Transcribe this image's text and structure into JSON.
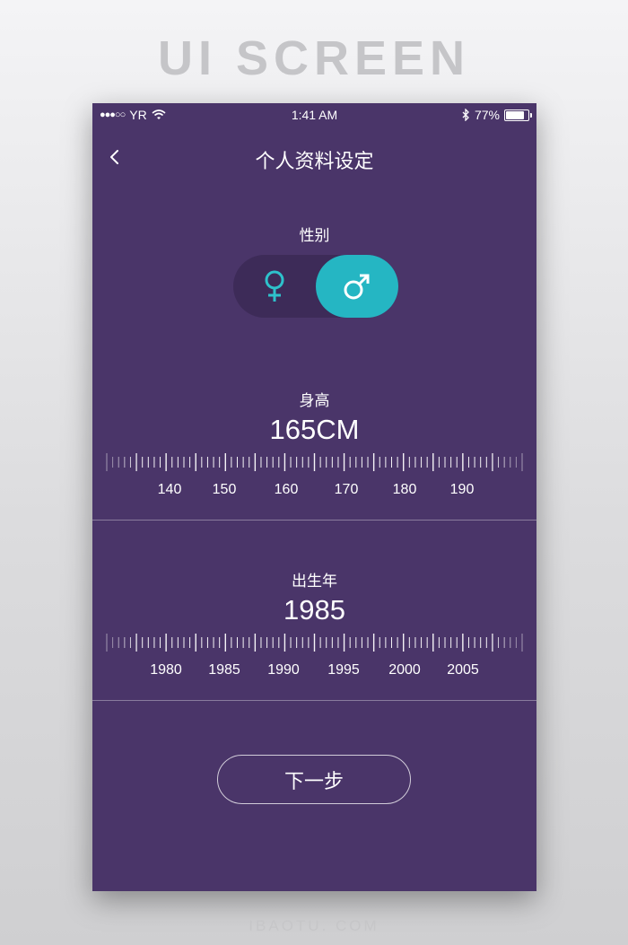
{
  "page_heading": "UI SCREEN",
  "footer_watermark": "IBAOTU. COM",
  "status_bar": {
    "carrier": "YR",
    "time": "1:41 AM",
    "battery": "77%",
    "battery_level": 0.77
  },
  "nav": {
    "title": "个人资料设定",
    "back_icon": "chevron-left-icon"
  },
  "gender": {
    "label": "性别",
    "options": [
      {
        "icon": "female-icon",
        "selected": false
      },
      {
        "icon": "male-icon",
        "selected": true
      }
    ]
  },
  "height": {
    "label": "身高",
    "value": "165CM",
    "ticks": [
      "140",
      "150",
      "160",
      "170",
      "180",
      "190"
    ]
  },
  "birth_year": {
    "label": "出生年",
    "value": "1985",
    "ticks": [
      "1980",
      "1985",
      "1990",
      "1995",
      "2000",
      "2005"
    ]
  },
  "next_button": "下一步",
  "colors": {
    "panel": "#4a3569",
    "toggle_track": "#3d2b58",
    "accent": "#25b6c3",
    "female_icon": "#2ec1cb"
  }
}
